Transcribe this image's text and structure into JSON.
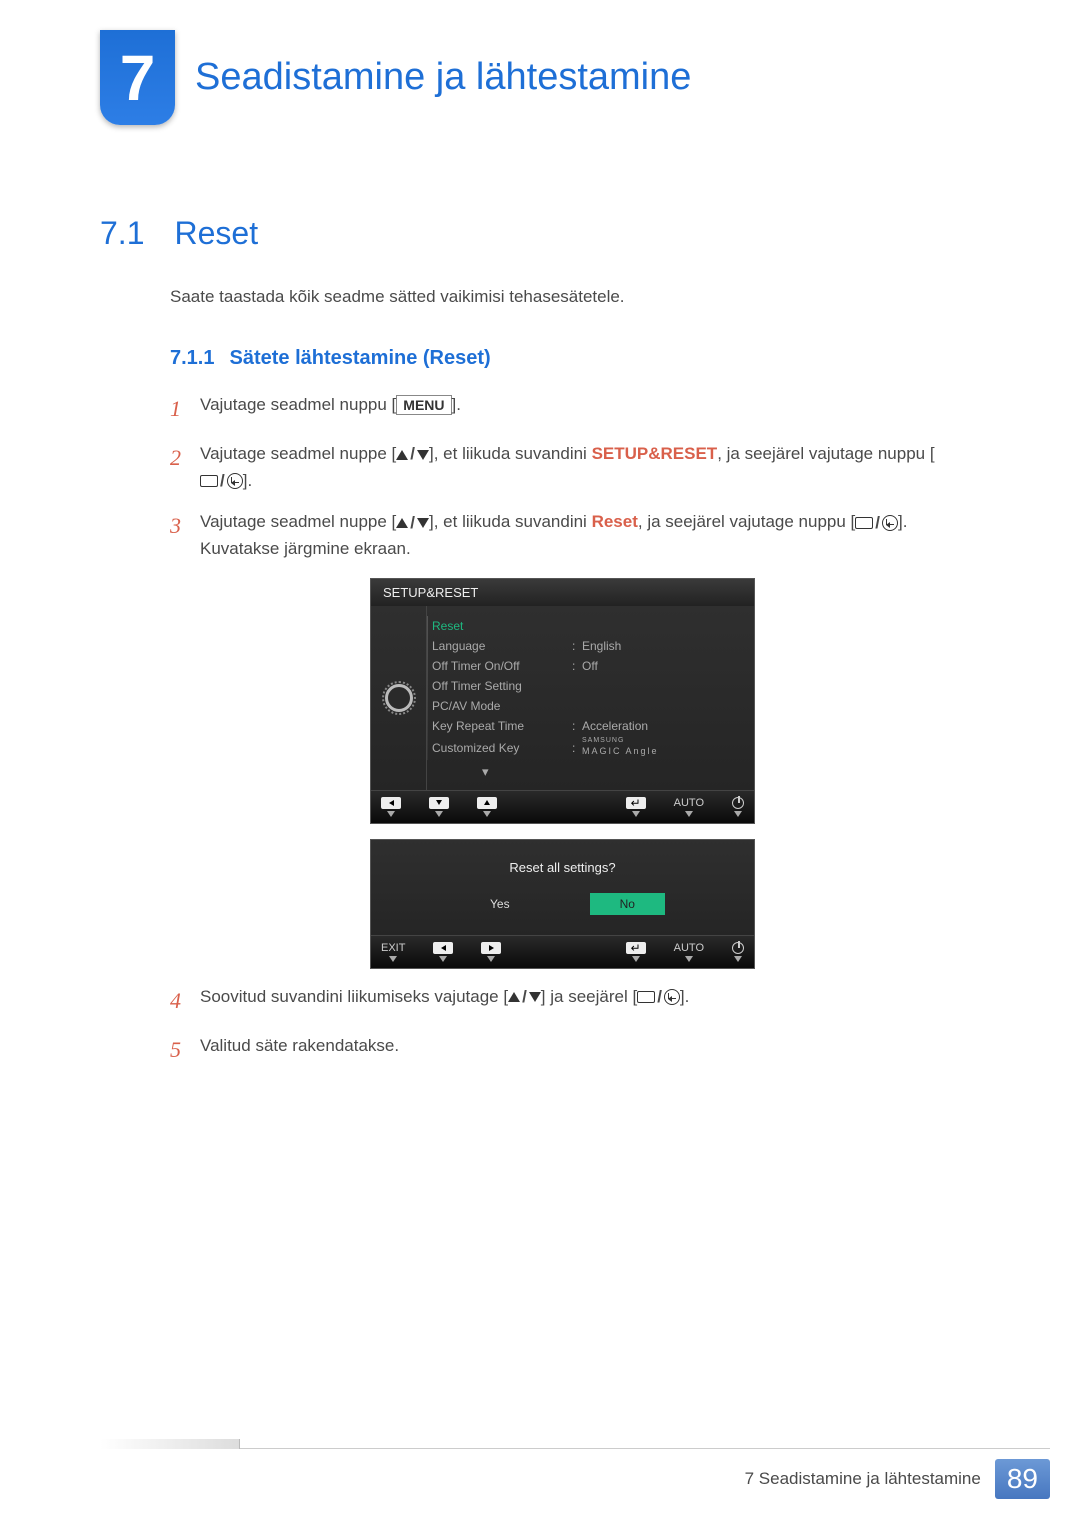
{
  "chapter": {
    "number": "7",
    "title": "Seadistamine ja lähtestamine"
  },
  "section": {
    "number": "7.1",
    "title": "Reset"
  },
  "intro": "Saate taastada kõik seadme sätted vaikimisi tehasesätetele.",
  "subsection": {
    "number": "7.1.1",
    "title": "Sätete lähtestamine (Reset)"
  },
  "steps": {
    "s1": {
      "num": "1",
      "text_a": "Vajutage seadmel nuppu [",
      "menu_label": "MENU",
      "text_b": "]."
    },
    "s2": {
      "num": "2",
      "text_a": "Vajutage seadmel nuppe [",
      "text_b": "], et liikuda suvandini ",
      "keyword": "SETUP&RESET",
      "text_c": ", ja seejärel vajutage nuppu [",
      "text_d": "]."
    },
    "s3": {
      "num": "3",
      "text_a": "Vajutage seadmel nuppe [",
      "text_b": "], et liikuda suvandini ",
      "keyword": "Reset",
      "text_c": ", ja seejärel vajutage nuppu [",
      "text_d": "]. Kuvatakse järgmine ekraan."
    },
    "s4": {
      "num": "4",
      "text_a": "Soovitud suvandini liikumiseks vajutage [",
      "text_b": "] ja seejärel [",
      "text_c": "]."
    },
    "s5": {
      "num": "5",
      "text": "Valitud säte rakendatakse."
    }
  },
  "osd1": {
    "title": "SETUP&RESET",
    "items": [
      {
        "label": "Reset",
        "value": "",
        "highlight": true
      },
      {
        "label": "Language",
        "value": "English"
      },
      {
        "label": "Off Timer On/Off",
        "value": "Off"
      },
      {
        "label": "Off Timer Setting",
        "value": ""
      },
      {
        "label": "PC/AV Mode",
        "value": ""
      },
      {
        "label": "Key Repeat Time",
        "value": "Acceleration"
      },
      {
        "label": "Customized Key",
        "value": "MAGIC Angle",
        "magic": true,
        "brand": "SAMSUNG"
      }
    ],
    "footer_auto": "AUTO"
  },
  "osd2": {
    "question": "Reset all settings?",
    "yes": "Yes",
    "no": "No",
    "exit": "EXIT",
    "auto": "AUTO"
  },
  "footer": {
    "chapter_label": "7 Seadistamine ja lähtestamine",
    "page_number": "89"
  }
}
